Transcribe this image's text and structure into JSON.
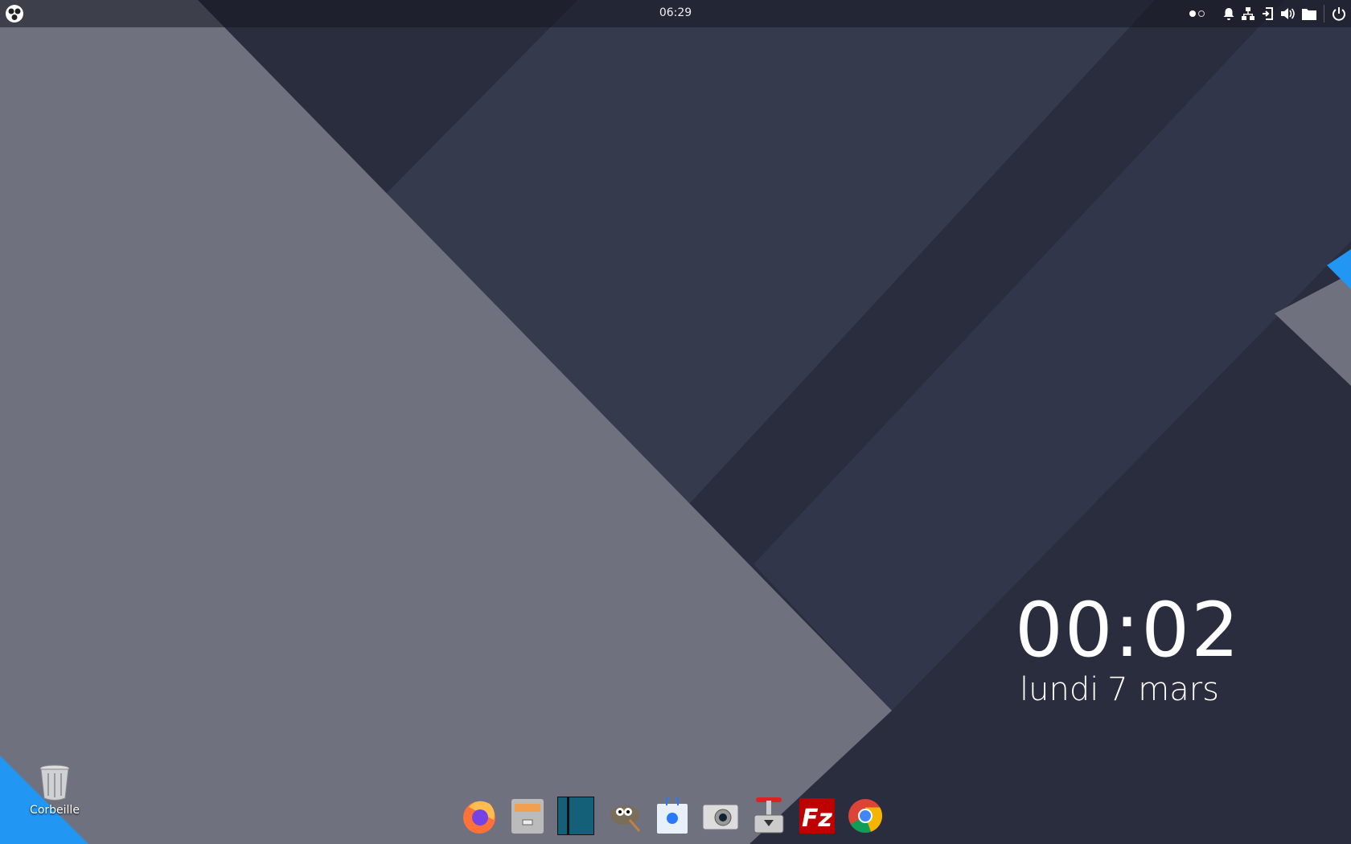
{
  "topbar": {
    "time": "06:29"
  },
  "tray": {
    "icons": [
      "workspace-dots",
      "notification-bell-icon",
      "network-icon",
      "logout-icon",
      "volume-icon",
      "folder-icon",
      "power-icon"
    ]
  },
  "clock_widget": {
    "time": "00:02",
    "day": "lundi",
    "date": "7 mars"
  },
  "desktop": {
    "trash_label": "Corbeille"
  },
  "dock": {
    "apps": [
      "Firefox",
      "Files",
      "Terminal",
      "GIMP",
      "Software Store",
      "Screenshot",
      "Installer",
      "FileZilla",
      "Chrome"
    ]
  },
  "colors": {
    "accent": "#2196f3",
    "wallpaper_light": "#6f717f",
    "wallpaper_dark": "#2a2d3e"
  }
}
